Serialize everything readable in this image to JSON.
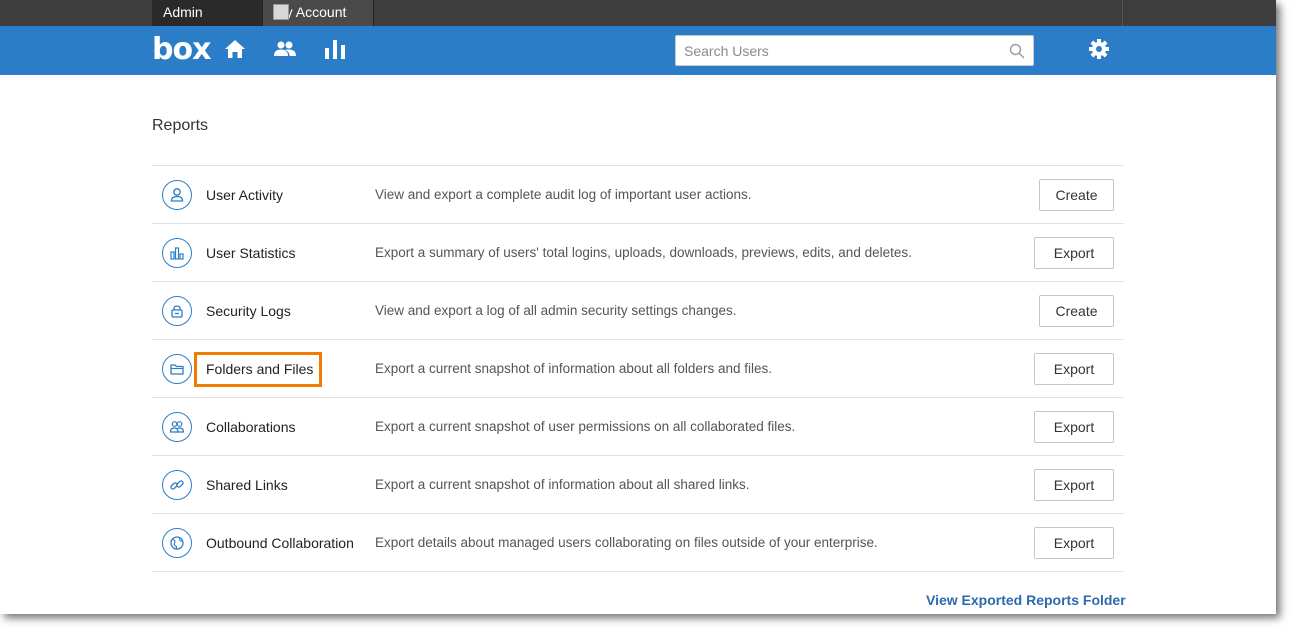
{
  "top_tabs": {
    "admin_console": "Admin Console",
    "my_account": "My Account"
  },
  "navbar": {
    "logo": "box",
    "search_placeholder": "Search Users",
    "icons": [
      "home-icon",
      "users-icon",
      "reports-icon",
      "search-icon",
      "gear-icon"
    ]
  },
  "colors": {
    "brand_blue": "#2c7dc7",
    "topbar": "#3d3d3d",
    "highlight": "#f07d00",
    "link": "#2c6aad"
  },
  "page": {
    "title": "Reports"
  },
  "reports": [
    {
      "name": "User Activity",
      "description": "View and export a complete audit log of important user actions.",
      "button": "Create",
      "icon": "user-icon"
    },
    {
      "name": "User Statistics",
      "description": "Export a summary of users' total logins, uploads, downloads, previews, edits, and deletes.",
      "button": "Export",
      "icon": "bar-chart-icon"
    },
    {
      "name": "Security Logs",
      "description": "View and export a log of all admin security settings changes.",
      "button": "Create",
      "icon": "lock-icon"
    },
    {
      "name": "Folders and Files",
      "description": "Export a current snapshot of information about all folders and files.",
      "button": "Export",
      "icon": "folder-icon"
    },
    {
      "name": "Collaborations",
      "description": "Export a current snapshot of user permissions on all collaborated files.",
      "button": "Export",
      "icon": "collaborators-icon"
    },
    {
      "name": "Shared Links",
      "description": "Export a current snapshot of information about all shared links.",
      "button": "Export",
      "icon": "link-icon"
    },
    {
      "name": "Outbound Collaboration",
      "description": "Export details about managed users collaborating on files outside of your enterprise.",
      "button": "Export",
      "icon": "globe-icon"
    }
  ],
  "footer": {
    "view_folder_link": "View Exported Reports Folder"
  }
}
